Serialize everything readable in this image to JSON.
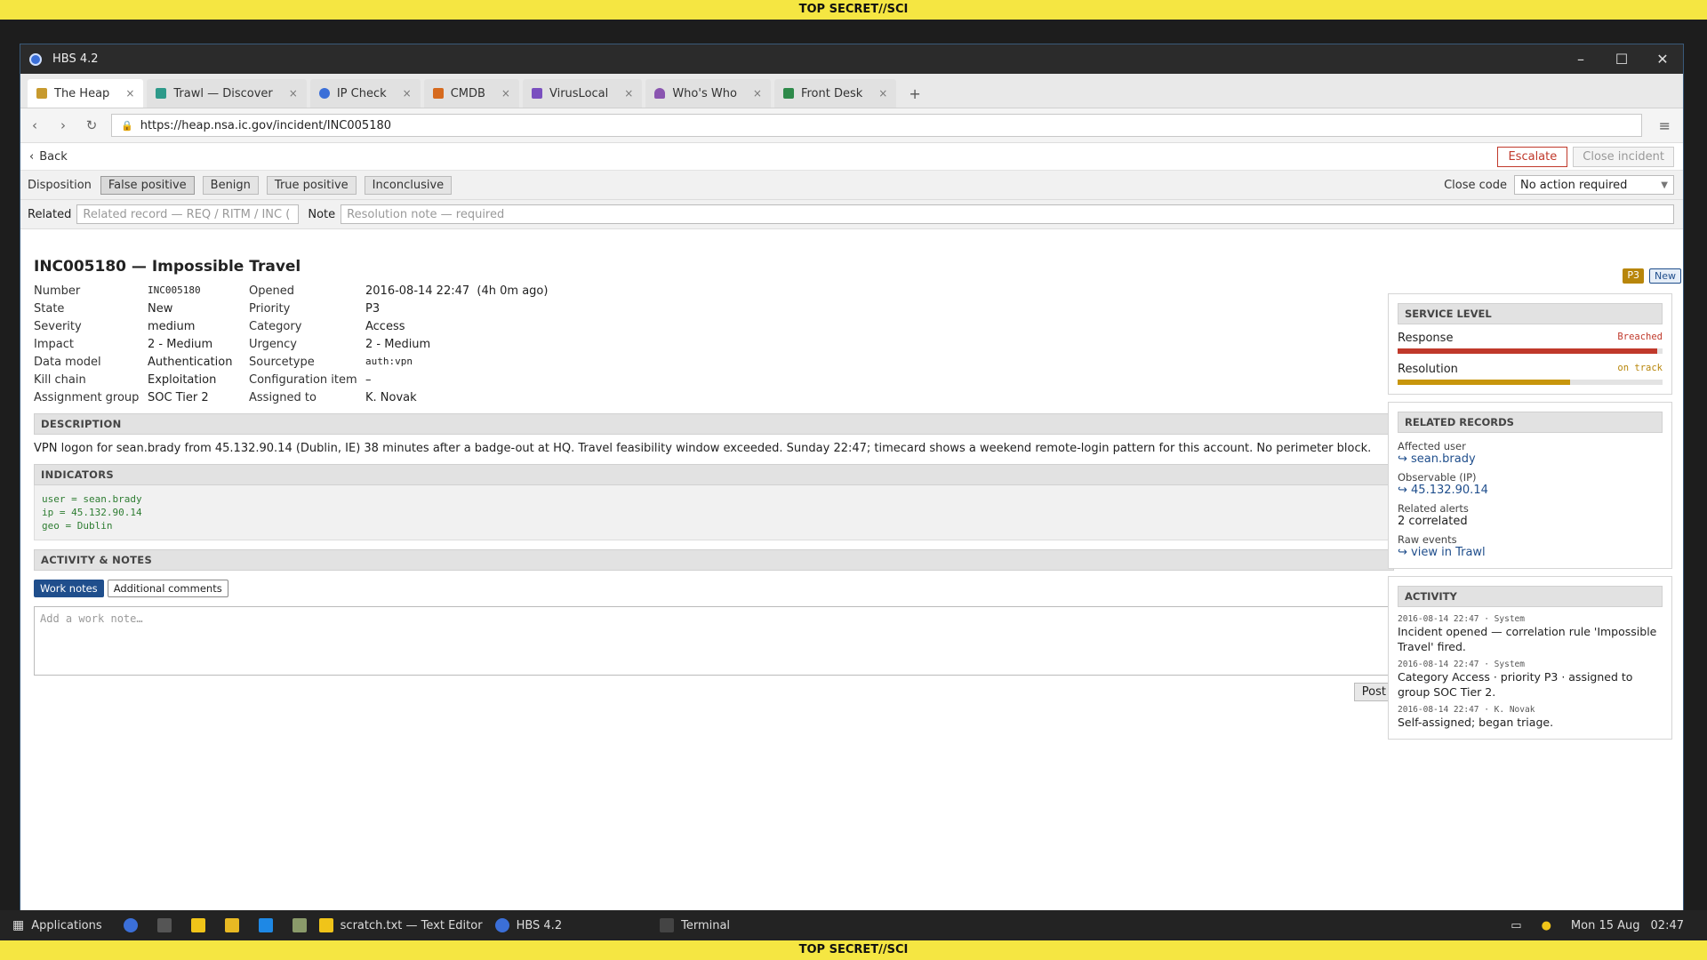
{
  "banner": "TOP SECRET//SCI",
  "window": {
    "title": "HBS 4.2"
  },
  "tabs": [
    {
      "label": "The Heap",
      "color": "#c79a2e"
    },
    {
      "label": "Trawl — Discover",
      "color": "#2e9a8a"
    },
    {
      "label": "IP Check",
      "color": "#3b6fd8"
    },
    {
      "label": "CMDB",
      "color": "#d66a1e"
    },
    {
      "label": "VirusLocal",
      "color": "#7a4fbf"
    },
    {
      "label": "Who's Who",
      "color": "#8a55b0"
    },
    {
      "label": "Front Desk",
      "color": "#2e8a4a"
    }
  ],
  "tab_add": "+",
  "nav": {
    "url": "https://heap.nsa.ic.gov/incident/INC005180",
    "back": "‹",
    "forward": "›",
    "reload": "↻",
    "menu": "≡"
  },
  "actions": {
    "back": "Back",
    "escalate": "Escalate",
    "close": "Close incident"
  },
  "disposition": {
    "label": "Disposition",
    "options": [
      "False positive",
      "Benign",
      "True positive",
      "Inconclusive"
    ],
    "close_code_label": "Close code",
    "close_code_value": "No action required"
  },
  "related": {
    "label": "Related",
    "placeholder": "Related record — REQ / RITM / INC (",
    "note_label": "Note",
    "note_placeholder": "Resolution note — required"
  },
  "incident": {
    "title": "INC005180 — Impossible Travel",
    "priority_badge": "P3",
    "state_badge": "New",
    "fields": [
      {
        "k": "Number",
        "v": "INC005180",
        "k2": "Opened",
        "v2": "2016-08-14 22:47  (4h 0m ago)"
      },
      {
        "k": "State",
        "v": "New",
        "k2": "Priority",
        "v2": "P3"
      },
      {
        "k": "Severity",
        "v": "medium",
        "k2": "Category",
        "v2": "Access"
      },
      {
        "k": "Impact",
        "v": "2 - Medium",
        "k2": "Urgency",
        "v2": "2 - Medium"
      },
      {
        "k": "Data model",
        "v": "Authentication",
        "k2": "Sourcetype",
        "v2": "auth:vpn"
      },
      {
        "k": "Kill chain",
        "v": "Exploitation",
        "k2": "Configuration item",
        "v2": "–"
      },
      {
        "k": "Assignment group",
        "v": "SOC Tier 2",
        "k2": "Assigned to",
        "v2": "K. Novak"
      }
    ],
    "description_header": "DESCRIPTION",
    "description": "VPN logon for sean.brady from 45.132.90.14 (Dublin, IE) 38 minutes after a badge-out at HQ. Travel feasibility window exceeded. Sunday 22:47; timecard shows a weekend remote-login pattern for this account. No perimeter block.",
    "indicators_header": "INDICATORS",
    "indicators": [
      "user = sean.brady",
      "ip = 45.132.90.14",
      "geo = Dublin"
    ],
    "activity_header": "ACTIVITY & NOTES",
    "note_tabs": [
      "Work notes",
      "Additional comments"
    ],
    "note_placeholder": "Add a work note…",
    "post": "Post"
  },
  "service_level": {
    "header": "SERVICE LEVEL",
    "items": [
      {
        "label": "Response",
        "status": "Breached",
        "status_color": "#c0392b",
        "fill": 0.98,
        "fill_color": "#c0392b"
      },
      {
        "label": "Resolution",
        "status": "on track",
        "status_color": "#b8860b",
        "fill": 0.65,
        "fill_color": "#c8960c"
      }
    ]
  },
  "related_records": {
    "header": "RELATED RECORDS",
    "affected_user_label": "Affected user",
    "affected_user": "↪ sean.brady",
    "observable_label": "Observable (IP)",
    "observable": "↪ 45.132.90.14",
    "alerts_label": "Related alerts",
    "alerts": "2 correlated",
    "raw_label": "Raw events",
    "raw": "↪ view in Trawl"
  },
  "activity": {
    "header": "ACTIVITY",
    "entries": [
      {
        "meta": "2016-08-14 22:47 · System",
        "text": "Incident opened — correlation rule 'Impossible Travel' fired."
      },
      {
        "meta": "2016-08-14 22:47 · System",
        "text": "Category Access · priority P3 · assigned to group SOC Tier 2."
      },
      {
        "meta": "2016-08-14 22:47 · K. Novak",
        "text": "Self-assigned; began triage."
      }
    ]
  },
  "taskbar": {
    "applications": "Applications",
    "editor": "scratch.txt — Text Editor",
    "hbs": "HBS 4.2",
    "terminal": "Terminal",
    "date": "Mon 15 Aug",
    "time": "02:47"
  }
}
